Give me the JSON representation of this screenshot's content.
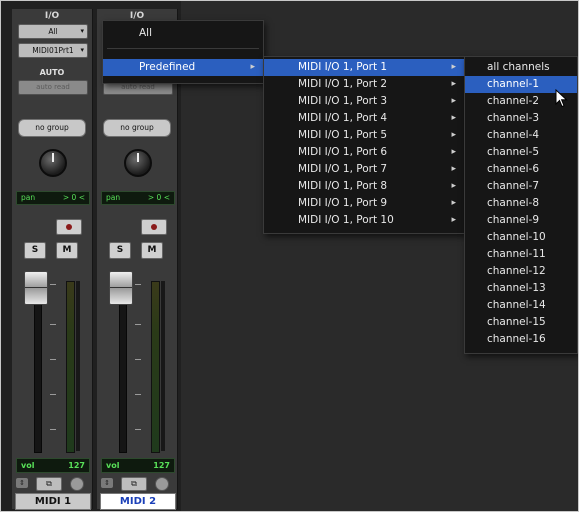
{
  "strips": [
    {
      "io_label": "I/O",
      "input": "All",
      "output": "MIDI01Prt1",
      "auto_label": "AUTO",
      "auto_value": "auto read",
      "group": "no group",
      "pan_label": "pan",
      "pan_value": "> 0 <",
      "solo": "S",
      "mute": "M",
      "vol_label": "vol",
      "vol_value": "127",
      "name": "MIDI 1"
    },
    {
      "io_label": "I/O",
      "input": "",
      "output": "",
      "auto_label": "",
      "auto_value": "auto read",
      "group": "no group",
      "pan_label": "pan",
      "pan_value": "> 0 <",
      "solo": "S",
      "mute": "M",
      "vol_label": "vol",
      "vol_value": "127",
      "name": "MIDI 2"
    }
  ],
  "menu_l1": {
    "items": [
      "All",
      "Predefined"
    ],
    "selected": "Predefined"
  },
  "menu_l2": {
    "items": [
      "MIDI I/O 1, Port 1",
      "MIDI I/O 1, Port 2",
      "MIDI I/O 1, Port 3",
      "MIDI I/O 1, Port 4",
      "MIDI I/O 1, Port 5",
      "MIDI I/O 1, Port 6",
      "MIDI I/O 1, Port 7",
      "MIDI I/O 1, Port 8",
      "MIDI I/O 1, Port 9",
      "MIDI I/O 1, Port 10"
    ],
    "selected": "MIDI I/O 1, Port 1"
  },
  "menu_l3": {
    "items": [
      "all channels",
      "channel-1",
      "channel-2",
      "channel-3",
      "channel-4",
      "channel-5",
      "channel-6",
      "channel-7",
      "channel-8",
      "channel-9",
      "channel-10",
      "channel-11",
      "channel-12",
      "channel-13",
      "channel-14",
      "channel-15",
      "channel-16"
    ],
    "selected": "channel-1"
  },
  "icons": {
    "submenu": "chevron-right-icon",
    "pointer": "mouse-pointer-icon",
    "record": "record-icon"
  },
  "colors": {
    "highlight": "#2b5fbf",
    "menu_bg": "#161616",
    "display_green": "#58e058",
    "selected_track_name": "#1a3fb8"
  }
}
